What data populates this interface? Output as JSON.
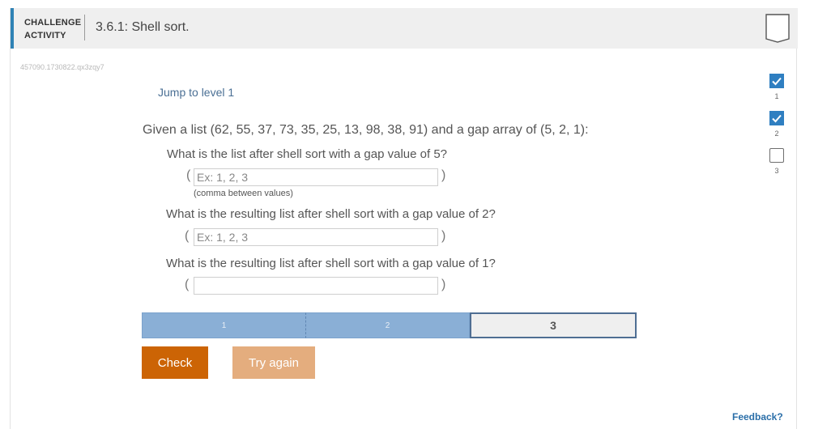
{
  "header": {
    "type_line1": "CHALLENGE",
    "type_line2": "ACTIVITY",
    "title": "3.6.1: Shell sort."
  },
  "activity_id": "457090.1730822.qx3zqy7",
  "jump_link": "Jump to level 1",
  "question": {
    "prompt": "Given a list (62, 55, 37, 73, 35, 25, 13, 98, 38, 91) and a gap array of (5, 2, 1):",
    "parts": [
      {
        "label": "What is the list after shell sort with a gap value of 5?",
        "placeholder": "Ex: 1, 2, 3",
        "value": "",
        "hint": "(comma between values)"
      },
      {
        "label": "What is the resulting list after shell sort with a gap value of 2?",
        "placeholder": "Ex: 1, 2, 3",
        "value": ""
      },
      {
        "label": "What is the resulting list after shell sort with a gap value of 1?",
        "placeholder": "",
        "value": ""
      }
    ],
    "paren_open": "(",
    "paren_close": ")"
  },
  "levels": {
    "items": [
      "1",
      "2",
      "3"
    ],
    "current": "3"
  },
  "buttons": {
    "check": "Check",
    "try_again": "Try again"
  },
  "feedback": "Feedback?",
  "progress": [
    {
      "label": "1",
      "completed": true
    },
    {
      "label": "2",
      "completed": true
    },
    {
      "label": "3",
      "completed": false
    }
  ],
  "colors": {
    "accent": "#2f82b5",
    "check": "#cc6405",
    "try_again": "#e4ad7e",
    "level_done": "#8aafd6",
    "level_current_border": "#4f6e93",
    "progress_done": "#2f7fc1"
  },
  "icons": {
    "bookmark": "bookmark-icon",
    "checkmark": "checkmark-icon"
  }
}
